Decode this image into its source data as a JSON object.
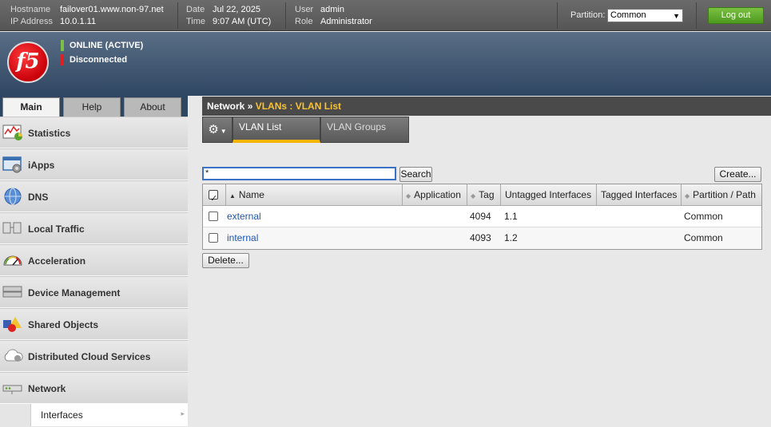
{
  "topbar": {
    "hostname_key": "Hostname",
    "hostname_val": "failover01.www.non-97.net",
    "ip_key": "IP Address",
    "ip_val": "10.0.1.11",
    "date_key": "Date",
    "date_val": "Jul 22, 2025",
    "time_key": "Time",
    "time_val": "9:07 AM (UTC)",
    "user_key": "User",
    "user_val": "admin",
    "role_key": "Role",
    "role_val": "Administrator",
    "partition_label": "Partition:",
    "partition_value": "Common",
    "logout_label": "Log out"
  },
  "banner": {
    "logo_text": "f5",
    "status_online": "ONLINE (ACTIVE)",
    "status_online_color": "#7ac043",
    "status_sync": "Disconnected",
    "status_sync_color": "#e02020"
  },
  "navtabs": [
    "Main",
    "Help",
    "About"
  ],
  "sidebar": {
    "items": [
      {
        "label": "Statistics",
        "icon": "statistics-icon"
      },
      {
        "label": "iApps",
        "icon": "iapps-icon"
      },
      {
        "label": "DNS",
        "icon": "dns-globe-icon"
      },
      {
        "label": "Local Traffic",
        "icon": "local-traffic-icon"
      },
      {
        "label": "Acceleration",
        "icon": "acceleration-gauge-icon"
      },
      {
        "label": "Device Management",
        "icon": "device-management-icon"
      },
      {
        "label": "Shared Objects",
        "icon": "shared-objects-icon"
      },
      {
        "label": "Distributed Cloud Services",
        "icon": "cloud-icon"
      },
      {
        "label": "Network",
        "icon": "network-icon"
      }
    ],
    "sub_items": [
      {
        "label": "Interfaces"
      }
    ]
  },
  "breadcrumb": {
    "root": "Network",
    "separator": "»",
    "current": "VLANs : VLAN List"
  },
  "subtabs": [
    "VLAN List",
    "VLAN Groups"
  ],
  "search": {
    "value": "*",
    "button": "Search"
  },
  "actions": {
    "create": "Create...",
    "delete": "Delete..."
  },
  "table": {
    "headers": [
      "Name",
      "Application",
      "Tag",
      "Untagged Interfaces",
      "Tagged Interfaces",
      "Partition / Path"
    ],
    "rows": [
      {
        "name": "external",
        "application": "",
        "tag": "4094",
        "untagged": "1.1",
        "tagged": "",
        "partition": "Common"
      },
      {
        "name": "internal",
        "application": "",
        "tag": "4093",
        "untagged": "1.2",
        "tagged": "",
        "partition": "Common"
      }
    ]
  }
}
